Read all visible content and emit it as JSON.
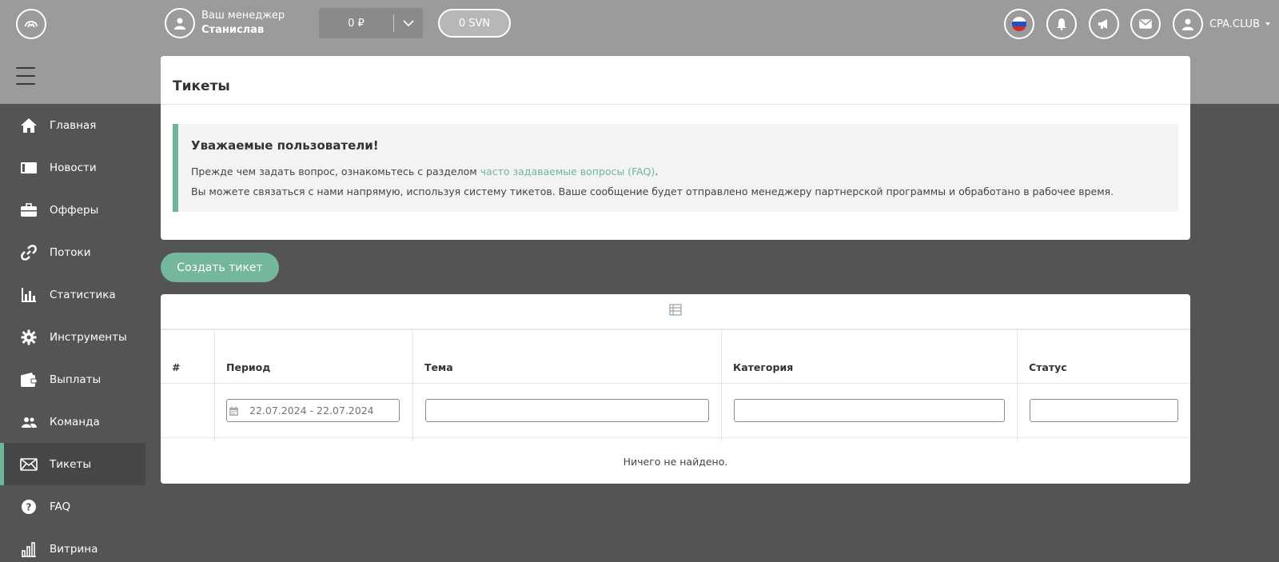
{
  "header": {
    "manager_label": "Ваш менеджер",
    "manager_name": "Станислав",
    "balance": "0 ₽",
    "svn_balance": "0 SVN",
    "user_name": "CPA.CLUB"
  },
  "sidebar": {
    "items": [
      {
        "label": "Главная",
        "icon": "home-icon"
      },
      {
        "label": "Новости",
        "icon": "news-icon"
      },
      {
        "label": "Офферы",
        "icon": "briefcase-icon"
      },
      {
        "label": "Потоки",
        "icon": "link-icon"
      },
      {
        "label": "Статистика",
        "icon": "chart-icon"
      },
      {
        "label": "Инструменты",
        "icon": "gear-icon"
      },
      {
        "label": "Выплаты",
        "icon": "wallet-icon"
      },
      {
        "label": "Команда",
        "icon": "team-icon"
      },
      {
        "label": "Тикеты",
        "icon": "envelope-icon",
        "active": true
      },
      {
        "label": "FAQ",
        "icon": "question-icon"
      },
      {
        "label": "Витрина",
        "icon": "showcase-icon"
      }
    ]
  },
  "page": {
    "title": "Тикеты",
    "alert_title": "Уважаемые пользователи!",
    "alert_line1_prefix": "Прежде чем задать вопрос, ознакомьтесь с разделом ",
    "alert_link": "часто задаваемые вопросы (FAQ)",
    "alert_line1_suffix": ".",
    "alert_line2": "Вы можете связаться с нами напрямую, используя систему тикетов. Ваше сообщение будет отправлено менеджеру партнерской программы и обработано в рабочее время.",
    "create_button": "Создать тикет"
  },
  "table": {
    "columns": [
      "#",
      "Период",
      "Тема",
      "Категория",
      "Статус"
    ],
    "period_placeholder": "22.07.2024 - 22.07.2024",
    "empty_text": "Ничего не найдено."
  },
  "colors": {
    "accent": "#6fb698",
    "topbar": "#9b9b9b",
    "background": "#545454"
  }
}
